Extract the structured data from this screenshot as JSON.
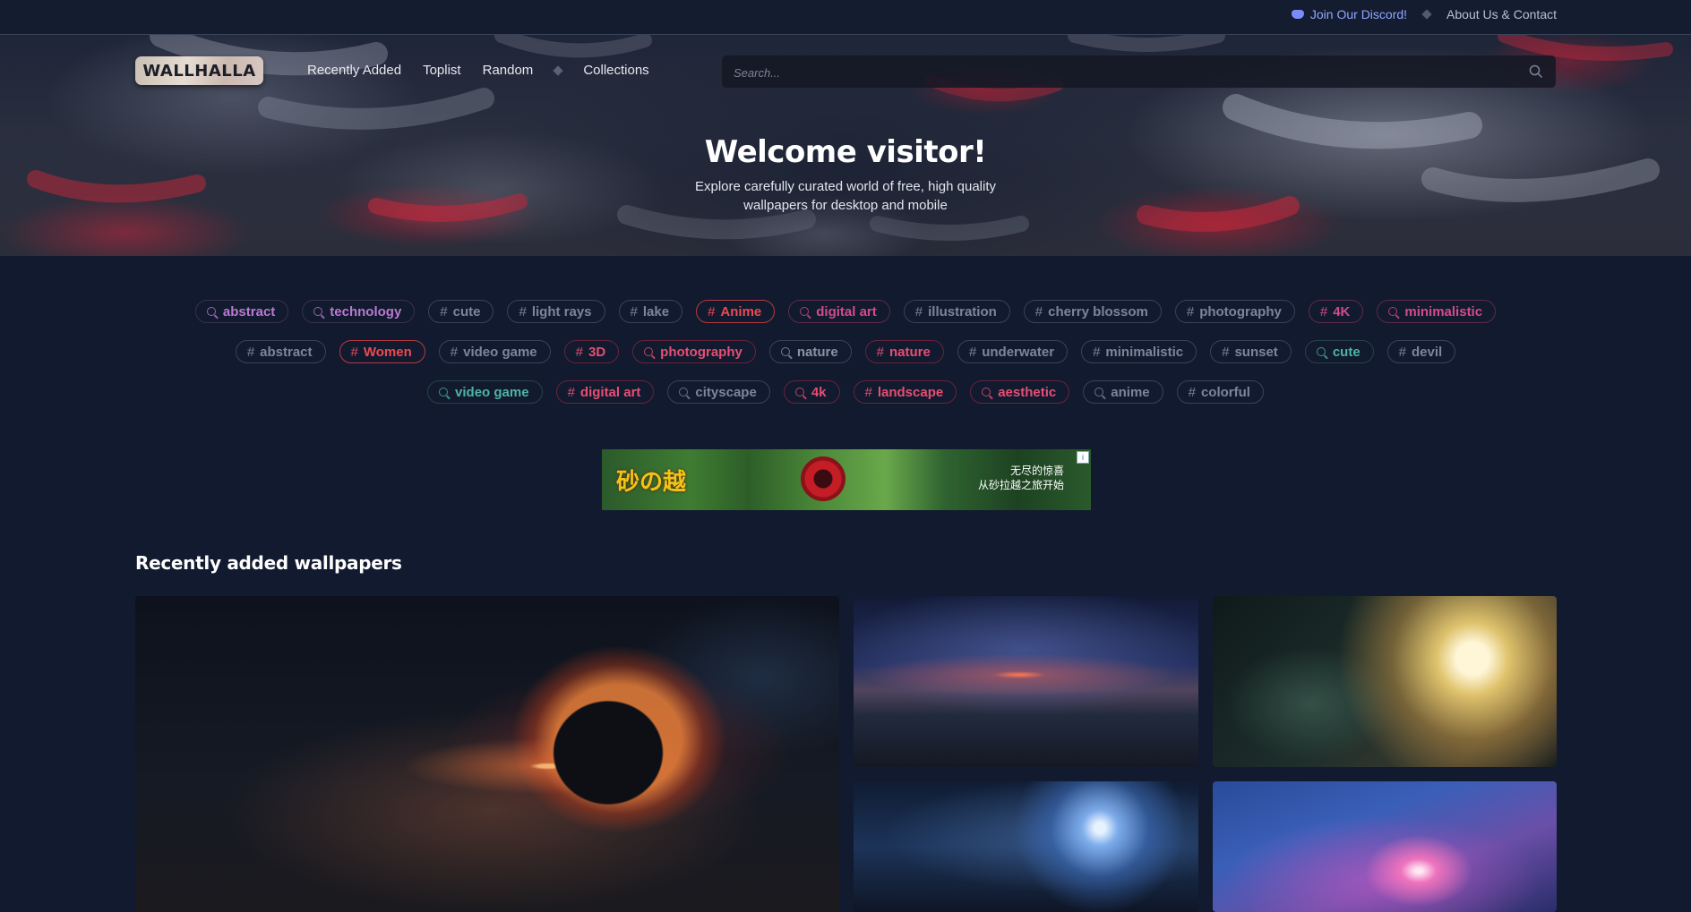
{
  "topbar": {
    "discord_label": "Join Our Discord!",
    "about_label": "About Us & Contact"
  },
  "header": {
    "logo_text": "WALLHALLA",
    "nav": [
      "Recently Added",
      "Toplist",
      "Random",
      "Collections"
    ],
    "search_placeholder": "Search..."
  },
  "hero": {
    "title": "Welcome visitor!",
    "subtitle": "Explore carefully curated world of free, high quality wallpapers for desktop and mobile"
  },
  "tags": {
    "row1": [
      {
        "label": "abstract",
        "icon": "search-icon",
        "glyph": "",
        "color": "purple"
      },
      {
        "label": "technology",
        "icon": "search-icon",
        "glyph": "",
        "color": "purple"
      },
      {
        "label": "cute",
        "icon": "hash-icon",
        "glyph": "#",
        "color": "gray"
      },
      {
        "label": "light rays",
        "icon": "hash-icon",
        "glyph": "#",
        "color": "gray"
      },
      {
        "label": "lake",
        "icon": "hash-icon",
        "glyph": "#",
        "color": "gray"
      },
      {
        "label": "Anime",
        "icon": "hash-icon",
        "glyph": "#",
        "color": "red"
      },
      {
        "label": "digital art",
        "icon": "search-icon",
        "glyph": "",
        "color": "magenta"
      },
      {
        "label": "illustration",
        "icon": "hash-icon",
        "glyph": "#",
        "color": "gray"
      },
      {
        "label": "cherry blossom",
        "icon": "hash-icon",
        "glyph": "#",
        "color": "gray"
      },
      {
        "label": "photography",
        "icon": "hash-icon",
        "glyph": "#",
        "color": "gray"
      },
      {
        "label": "4K",
        "icon": "hash-icon",
        "glyph": "#",
        "color": "magenta"
      },
      {
        "label": "minimalistic",
        "icon": "search-icon",
        "glyph": "",
        "color": "magenta"
      }
    ],
    "row2": [
      {
        "label": "abstract",
        "icon": "hash-icon",
        "glyph": "#",
        "color": "gray"
      },
      {
        "label": "Women",
        "icon": "hash-icon",
        "glyph": "#",
        "color": "red"
      },
      {
        "label": "video game",
        "icon": "hash-icon",
        "glyph": "#",
        "color": "gray"
      },
      {
        "label": "3D",
        "icon": "hash-icon",
        "glyph": "#",
        "color": "rose"
      },
      {
        "label": "photography",
        "icon": "search-icon",
        "glyph": "",
        "color": "rose"
      },
      {
        "label": "nature",
        "icon": "search-icon",
        "glyph": "",
        "color": "grayb"
      },
      {
        "label": "nature",
        "icon": "hash-icon",
        "glyph": "#",
        "color": "rose"
      },
      {
        "label": "underwater",
        "icon": "hash-icon",
        "glyph": "#",
        "color": "gray"
      },
      {
        "label": "minimalistic",
        "icon": "hash-icon",
        "glyph": "#",
        "color": "gray"
      },
      {
        "label": "sunset",
        "icon": "hash-icon",
        "glyph": "#",
        "color": "gray"
      },
      {
        "label": "cute",
        "icon": "search-icon",
        "glyph": "",
        "color": "teal"
      },
      {
        "label": "devil",
        "icon": "hash-icon",
        "glyph": "#",
        "color": "gray"
      }
    ],
    "row3": [
      {
        "label": "video game",
        "icon": "search-icon",
        "glyph": "",
        "color": "teal"
      },
      {
        "label": "digital art",
        "icon": "hash-icon",
        "glyph": "#",
        "color": "rose"
      },
      {
        "label": "cityscape",
        "icon": "search-icon",
        "glyph": "",
        "color": "gray"
      },
      {
        "label": "4k",
        "icon": "search-icon",
        "glyph": "",
        "color": "rose"
      },
      {
        "label": "landscape",
        "icon": "hash-icon",
        "glyph": "#",
        "color": "rose"
      },
      {
        "label": "aesthetic",
        "icon": "search-icon",
        "glyph": "",
        "color": "rose"
      },
      {
        "label": "anime",
        "icon": "search-icon",
        "glyph": "",
        "color": "gray"
      },
      {
        "label": "colorful",
        "icon": "hash-icon",
        "glyph": "#",
        "color": "gray"
      }
    ]
  },
  "ad": {
    "title": "砂の越",
    "text_line1": "无尽的惊喜",
    "text_line2": "从砂拉越之旅开始",
    "badge": "i"
  },
  "recent": {
    "title": "Recently added wallpapers"
  },
  "colors": {
    "background": "#111a2e",
    "accent_red": "#ec4a52",
    "accent_purple": "#b97ad0",
    "accent_teal": "#4fb3a5",
    "discord": "#8ea7ff"
  }
}
